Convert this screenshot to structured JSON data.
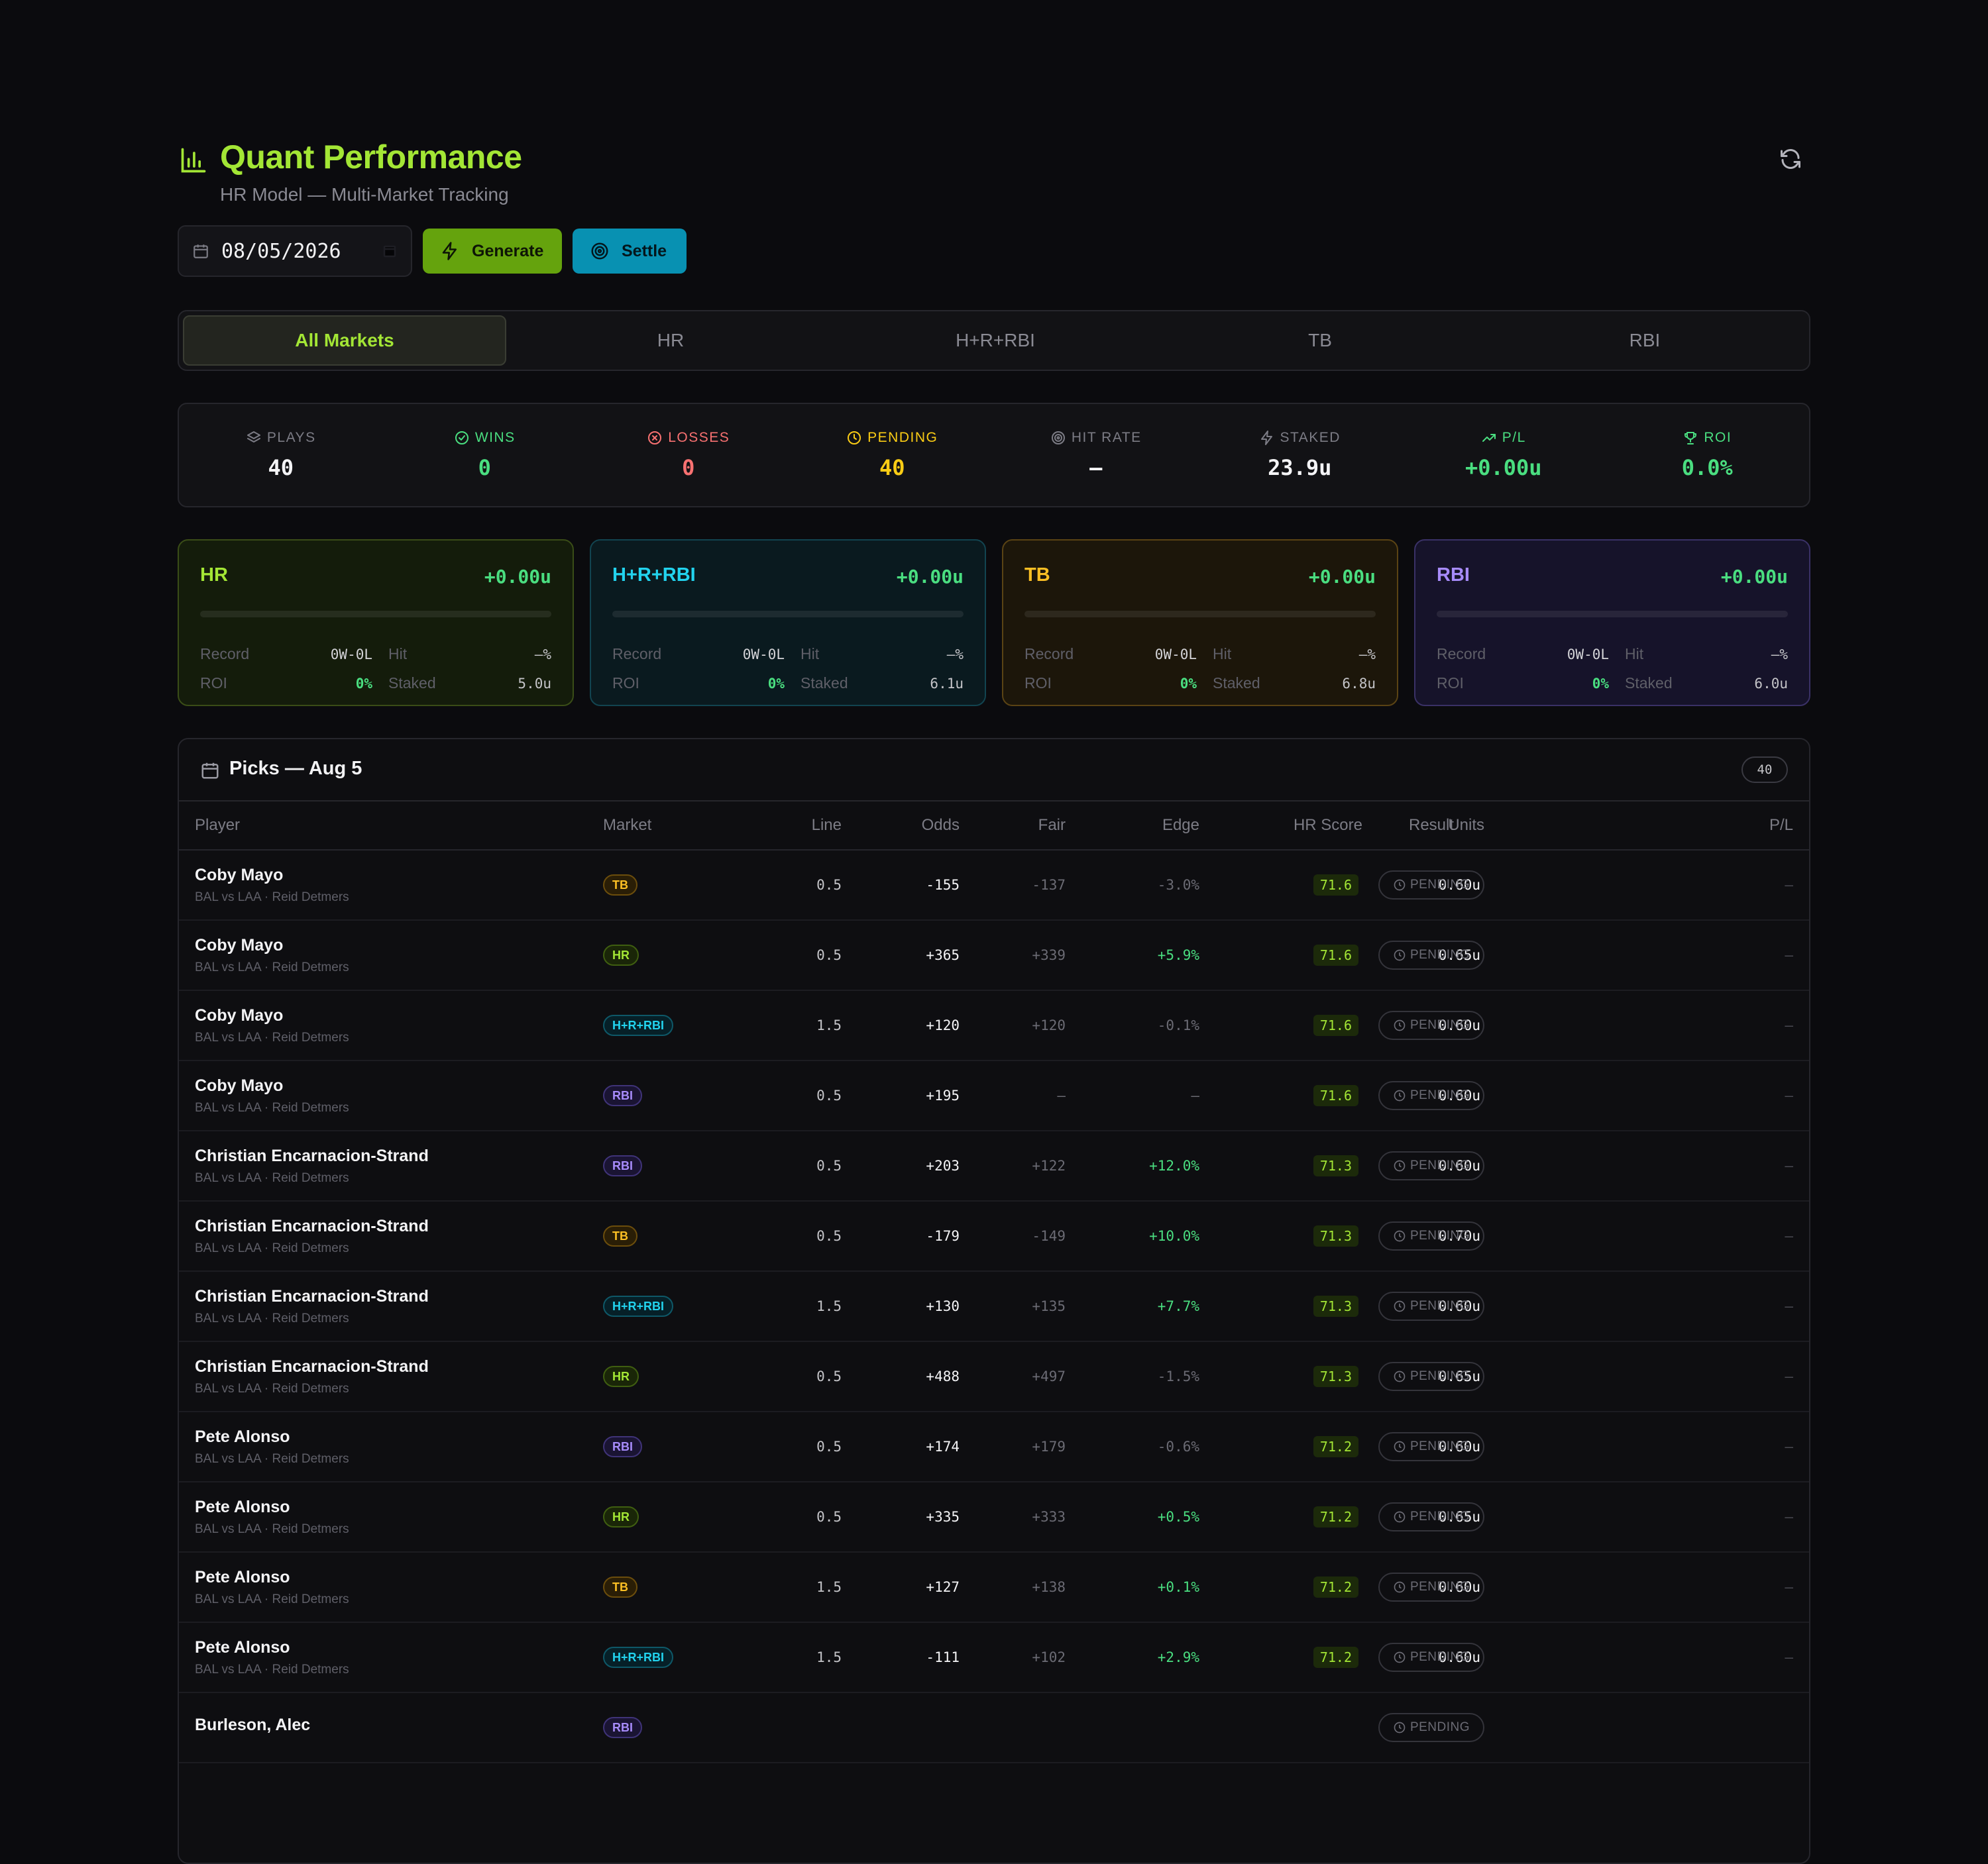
{
  "header": {
    "title": "Quant Performance",
    "subtitle": "HR Model — Multi-Market Tracking"
  },
  "controls": {
    "date": "08/05/2026",
    "generate_label": "Generate",
    "settle_label": "Settle"
  },
  "tabs": [
    "All Markets",
    "HR",
    "H+R+RBI",
    "TB",
    "RBI"
  ],
  "stats": [
    {
      "label": "PLAYS",
      "value": "40",
      "color": "#f4f4f6",
      "labelColor": "#7c7c85",
      "icon": "layers-icon"
    },
    {
      "label": "WINS",
      "value": "0",
      "color": "#4ade80",
      "labelColor": "#4ade80",
      "icon": "check-circle-icon"
    },
    {
      "label": "LOSSES",
      "value": "0",
      "color": "#f87171",
      "labelColor": "#f87171",
      "icon": "x-circle-icon"
    },
    {
      "label": "PENDING",
      "value": "40",
      "color": "#facc15",
      "labelColor": "#facc15",
      "icon": "clock-icon"
    },
    {
      "label": "HIT RATE",
      "value": "—",
      "color": "#f4f4f6",
      "labelColor": "#7c7c85",
      "icon": "target-icon"
    },
    {
      "label": "STAKED",
      "value": "23.9u",
      "color": "#f4f4f6",
      "labelColor": "#7c7c85",
      "icon": "bolt-icon"
    },
    {
      "label": "P/L",
      "value": "+0.00u",
      "color": "#4ade80",
      "labelColor": "#4ade80",
      "icon": "trending-up-icon"
    },
    {
      "label": "ROI",
      "value": "0.0%",
      "color": "#4ade80",
      "labelColor": "#4ade80",
      "icon": "trophy-icon"
    }
  ],
  "markets": [
    {
      "name": "HR",
      "pl": "+0.00u",
      "record_label": "Record",
      "record": "0W-0L",
      "hit_label": "Hit",
      "hit": "—%",
      "roi_label": "ROI",
      "roi": "0%",
      "staked_label": "Staked",
      "staked": "5.0u",
      "color": "#a3e635",
      "bg": "#141c0b",
      "border": "#3a4d17"
    },
    {
      "name": "H+R+RBI",
      "pl": "+0.00u",
      "record_label": "Record",
      "record": "0W-0L",
      "hit_label": "Hit",
      "hit": "—%",
      "roi_label": "ROI",
      "roi": "0%",
      "staked_label": "Staked",
      "staked": "6.1u",
      "color": "#22d3ee",
      "bg": "#0a1a1f",
      "border": "#124450"
    },
    {
      "name": "TB",
      "pl": "+0.00u",
      "record_label": "Record",
      "record": "0W-0L",
      "hit_label": "Hit",
      "hit": "—%",
      "roi_label": "ROI",
      "roi": "0%",
      "staked_label": "Staked",
      "staked": "6.8u",
      "color": "#fbbf24",
      "bg": "#1c160a",
      "border": "#5a4314"
    },
    {
      "name": "RBI",
      "pl": "+0.00u",
      "record_label": "Record",
      "record": "0W-0L",
      "hit_label": "Hit",
      "hit": "—%",
      "roi_label": "ROI",
      "roi": "0%",
      "staked_label": "Staked",
      "staked": "6.0u",
      "color": "#a78bfa",
      "bg": "#16132a",
      "border": "#3a3166"
    }
  ],
  "picks": {
    "title": "Picks — Aug 5",
    "count": "40",
    "columns": [
      "Player",
      "Market",
      "Line",
      "Odds",
      "Fair",
      "Edge",
      "HR Score",
      "Units",
      "Result",
      "P/L"
    ],
    "rows": [
      {
        "player": "Coby Mayo",
        "game": "BAL vs LAA · Reid Detmers",
        "market": "TB",
        "line": "0.5",
        "odds": "-155",
        "fair": "-137",
        "edge": "-3.0%",
        "score": "71.6",
        "units": "0.60u",
        "result": "PENDING",
        "pl": "—"
      },
      {
        "player": "Coby Mayo",
        "game": "BAL vs LAA · Reid Detmers",
        "market": "HR",
        "line": "0.5",
        "odds": "+365",
        "fair": "+339",
        "edge": "+5.9%",
        "score": "71.6",
        "units": "0.65u",
        "result": "PENDING",
        "pl": "—"
      },
      {
        "player": "Coby Mayo",
        "game": "BAL vs LAA · Reid Detmers",
        "market": "H+R+RBI",
        "line": "1.5",
        "odds": "+120",
        "fair": "+120",
        "edge": "-0.1%",
        "score": "71.6",
        "units": "0.60u",
        "result": "PENDING",
        "pl": "—"
      },
      {
        "player": "Coby Mayo",
        "game": "BAL vs LAA · Reid Detmers",
        "market": "RBI",
        "line": "0.5",
        "odds": "+195",
        "fair": "—",
        "edge": "—",
        "score": "71.6",
        "units": "0.60u",
        "result": "PENDING",
        "pl": "—"
      },
      {
        "player": "Christian Encarnacion-Strand",
        "game": "BAL vs LAA · Reid Detmers",
        "market": "RBI",
        "line": "0.5",
        "odds": "+203",
        "fair": "+122",
        "edge": "+12.0%",
        "score": "71.3",
        "units": "0.60u",
        "result": "PENDING",
        "pl": "—"
      },
      {
        "player": "Christian Encarnacion-Strand",
        "game": "BAL vs LAA · Reid Detmers",
        "market": "TB",
        "line": "0.5",
        "odds": "-179",
        "fair": "-149",
        "edge": "+10.0%",
        "score": "71.3",
        "units": "0.70u",
        "result": "PENDING",
        "pl": "—"
      },
      {
        "player": "Christian Encarnacion-Strand",
        "game": "BAL vs LAA · Reid Detmers",
        "market": "H+R+RBI",
        "line": "1.5",
        "odds": "+130",
        "fair": "+135",
        "edge": "+7.7%",
        "score": "71.3",
        "units": "0.60u",
        "result": "PENDING",
        "pl": "—"
      },
      {
        "player": "Christian Encarnacion-Strand",
        "game": "BAL vs LAA · Reid Detmers",
        "market": "HR",
        "line": "0.5",
        "odds": "+488",
        "fair": "+497",
        "edge": "-1.5%",
        "score": "71.3",
        "units": "0.65u",
        "result": "PENDING",
        "pl": "—"
      },
      {
        "player": "Pete Alonso",
        "game": "BAL vs LAA · Reid Detmers",
        "market": "RBI",
        "line": "0.5",
        "odds": "+174",
        "fair": "+179",
        "edge": "-0.6%",
        "score": "71.2",
        "units": "0.60u",
        "result": "PENDING",
        "pl": "—"
      },
      {
        "player": "Pete Alonso",
        "game": "BAL vs LAA · Reid Detmers",
        "market": "HR",
        "line": "0.5",
        "odds": "+335",
        "fair": "+333",
        "edge": "+0.5%",
        "score": "71.2",
        "units": "0.65u",
        "result": "PENDING",
        "pl": "—"
      },
      {
        "player": "Pete Alonso",
        "game": "BAL vs LAA · Reid Detmers",
        "market": "TB",
        "line": "1.5",
        "odds": "+127",
        "fair": "+138",
        "edge": "+0.1%",
        "score": "71.2",
        "units": "0.60u",
        "result": "PENDING",
        "pl": "—"
      },
      {
        "player": "Pete Alonso",
        "game": "BAL vs LAA · Reid Detmers",
        "market": "H+R+RBI",
        "line": "1.5",
        "odds": "-111",
        "fair": "+102",
        "edge": "+2.9%",
        "score": "71.2",
        "units": "0.60u",
        "result": "PENDING",
        "pl": "—"
      },
      {
        "player": "Burleson, Alec",
        "game": "",
        "market": "RBI",
        "line": "",
        "odds": "",
        "fair": "",
        "edge": "",
        "score": "",
        "units": "",
        "result": "PENDING",
        "pl": ""
      }
    ]
  }
}
